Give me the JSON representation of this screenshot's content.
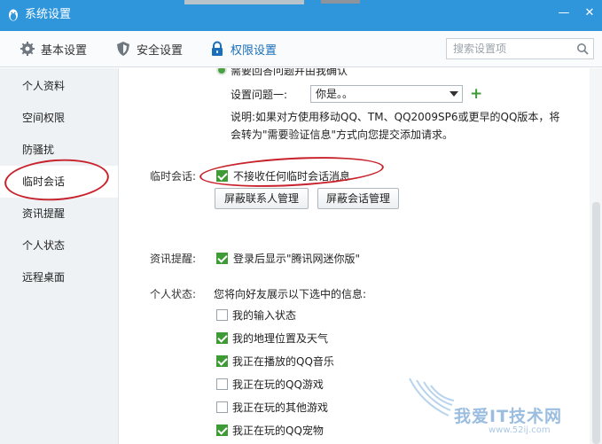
{
  "window": {
    "title": "系统设置",
    "minimize_glyph": "—",
    "close_glyph": "✕"
  },
  "toolbar": {
    "tabs": [
      {
        "label": "基本设置",
        "icon": "gear-icon"
      },
      {
        "label": "安全设置",
        "icon": "shield-icon"
      },
      {
        "label": "权限设置",
        "icon": "lock-icon",
        "active": true
      }
    ],
    "search_placeholder": "搜索设置项"
  },
  "sidebar": {
    "items": [
      {
        "label": "个人资料"
      },
      {
        "label": "空间权限"
      },
      {
        "label": "防骚扰"
      },
      {
        "label": "临时会话",
        "active": true
      },
      {
        "label": "资讯提醒"
      },
      {
        "label": "个人状态"
      },
      {
        "label": "远程桌面"
      }
    ]
  },
  "content": {
    "verify": {
      "radio_label": "需要回答问题并由我确认",
      "question_label": "设置问题一:",
      "question_value": "你是。。",
      "note_line1": "说明:如果对方使用移动QQ、TM、QQ2009SP6或更早的QQ版本，将",
      "note_line2": "会转为\"需要验证信息\"方式向您提交添加请求。"
    },
    "temp_session": {
      "label": "临时会话:",
      "checkbox_label": "不接收任何临时会话消息",
      "checked": true,
      "buttons": [
        "屏蔽联系人管理",
        "屏蔽会话管理"
      ]
    },
    "news": {
      "label": "资讯提醒:",
      "checkbox_label": "登录后显示\"腾讯网迷你版\"",
      "checked": true
    },
    "status": {
      "label": "个人状态:",
      "intro": "您将向好友展示以下选中的信息:",
      "options": [
        {
          "label": "我的输入状态",
          "checked": false
        },
        {
          "label": "我的地理位置及天气",
          "checked": true
        },
        {
          "label": "我正在播放的QQ音乐",
          "checked": true
        },
        {
          "label": "我正在玩的QQ游戏",
          "checked": false
        },
        {
          "label": "我正在玩的其他游戏",
          "checked": false
        },
        {
          "label": "我正在玩的QQ宠物",
          "checked": true
        }
      ]
    }
  },
  "watermark": {
    "text": "我爱IT技术网",
    "url": "www.52ij.com"
  },
  "colors": {
    "titlebar": "#2f96dc",
    "accent": "#1a6fb8",
    "check_green": "#3f9b36",
    "annotation_red": "#c8232c"
  }
}
